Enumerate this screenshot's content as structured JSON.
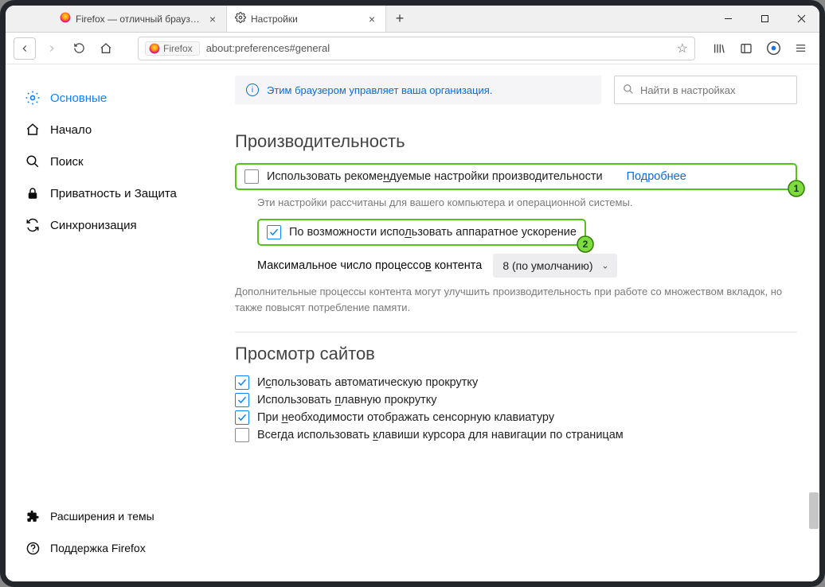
{
  "tabs": [
    {
      "label": "Firefox — отличный браузер д",
      "active": false
    },
    {
      "label": "Настройки",
      "active": true
    }
  ],
  "urlbar": {
    "brand": "Firefox",
    "url": "about:preferences#general"
  },
  "banner": "Этим браузером управляет ваша организация.",
  "search_placeholder": "Найти в настройках",
  "sidebar": {
    "items": [
      {
        "label": "Основные"
      },
      {
        "label": "Начало"
      },
      {
        "label": "Поиск"
      },
      {
        "label": "Приватность и Защита"
      },
      {
        "label": "Синхронизация"
      }
    ],
    "bottom": [
      {
        "label": "Расширения и темы"
      },
      {
        "label": "Поддержка Firefox"
      }
    ]
  },
  "perf": {
    "heading": "Производительность",
    "use_recommended_pre": "Использовать рекоме",
    "use_recommended_ak": "н",
    "use_recommended_post": "дуемые настройки производительности",
    "learn_more": "Подробнее",
    "desc": "Эти настройки рассчитаны для вашего компьютера и операционной системы.",
    "hwaccel_pre": "По возможности испо",
    "hwaccel_ak": "л",
    "hwaccel_post": "ьзовать аппаратное ускорение",
    "max_proc_pre": "Максимальное число процессо",
    "max_proc_ak": "в",
    "max_proc_post": " контента",
    "max_proc_value": "8 (по умолчанию)",
    "desc2": "Дополнительные процессы контента могут улучшить производительность при работе со множеством вкладок, но также повысят потребление памяти."
  },
  "browsing": {
    "heading": "Просмотр сайтов",
    "autoscroll": "Использовать автоматическую прокрутку",
    "autoscroll_ak": "с",
    "smooth": "Использовать плавную прокрутку",
    "smooth_ak": "п",
    "touchkb_pre": "При ",
    "touchkb_ak": "н",
    "touchkb_post": "еобходимости отображать сенсорную клавиатуру",
    "caret_pre": "Всегда использовать ",
    "caret_ak": "к",
    "caret_post": "лавиши курсора для навигации по страницам"
  },
  "annotations": {
    "1": "1",
    "2": "2"
  }
}
